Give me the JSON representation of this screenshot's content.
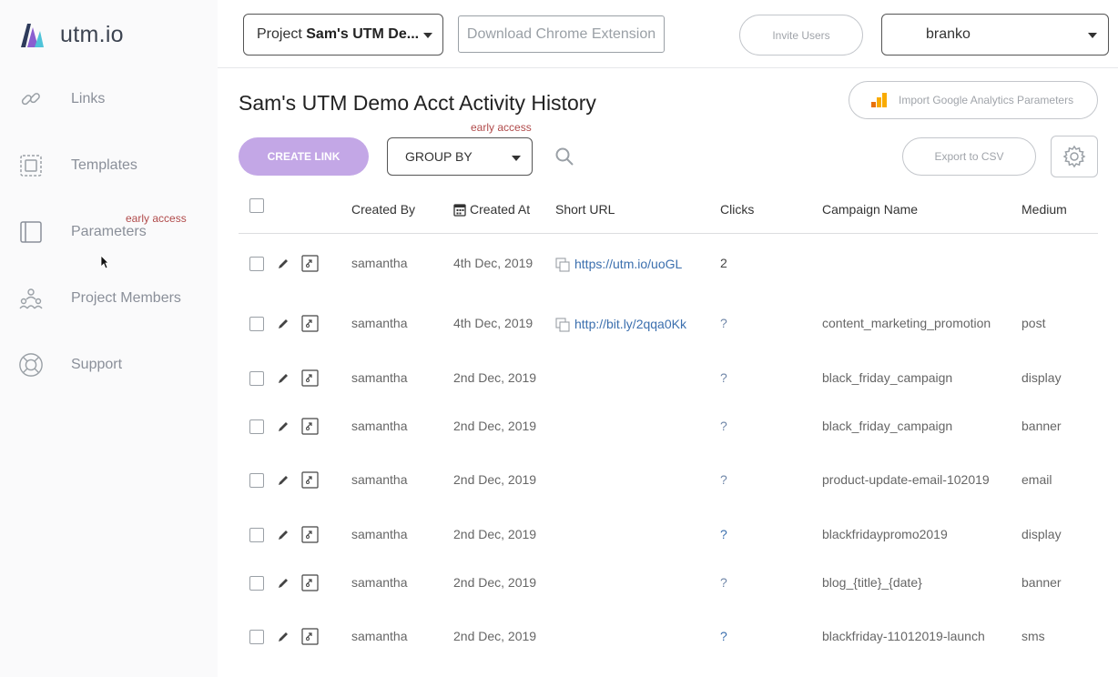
{
  "app": {
    "name": "utm.io"
  },
  "sidebar": {
    "items": [
      {
        "label": "Links",
        "icon": "link-icon"
      },
      {
        "label": "Templates",
        "icon": "template-icon"
      },
      {
        "label": "Parameters",
        "icon": "parameters-icon",
        "badge": "early access"
      },
      {
        "label": "Project Members",
        "icon": "members-icon"
      },
      {
        "label": "Support",
        "icon": "lifebuoy-icon"
      }
    ]
  },
  "header": {
    "project_prefix": "Project ",
    "project_name": "Sam's UTM De...",
    "extension_label": "Download Chrome Extension",
    "invite_label": "Invite Users",
    "user_name": "branko"
  },
  "main": {
    "title": "Sam's UTM Demo Acct Activity History",
    "import_label": "Import Google Analytics Parameters",
    "create_label": "CREATE LINK",
    "group_early": "early access",
    "group_label": "GROUP BY",
    "export_label": "Export to CSV"
  },
  "table": {
    "columns": [
      "Created By",
      "Created At",
      "Short URL",
      "Clicks",
      "Campaign Name",
      "Medium"
    ],
    "rows": [
      {
        "created_by": "samantha",
        "created_at": "4th Dec, 2019",
        "short_url": "https://utm.io/uoGL",
        "clicks": "2",
        "campaign": "",
        "medium": ""
      },
      {
        "created_by": "samantha",
        "created_at": "4th Dec, 2019",
        "short_url": "http://bit.ly/2qqa0Kk",
        "clicks": "?",
        "campaign": "content_marketing_promotion",
        "medium": "post"
      },
      {
        "created_by": "samantha",
        "created_at": "2nd Dec, 2019",
        "short_url": "",
        "clicks": "?",
        "campaign": "black_friday_campaign",
        "medium": "display"
      },
      {
        "created_by": "samantha",
        "created_at": "2nd Dec, 2019",
        "short_url": "",
        "clicks": "?",
        "campaign": "black_friday_campaign",
        "medium": "banner"
      },
      {
        "created_by": "samantha",
        "created_at": "2nd Dec, 2019",
        "short_url": "",
        "clicks": "?",
        "campaign": "product-update-email-102019",
        "medium": "email"
      },
      {
        "created_by": "samantha",
        "created_at": "2nd Dec, 2019",
        "short_url": "",
        "clicks": "?",
        "campaign": "blackfridaypromo2019",
        "medium": "display"
      },
      {
        "created_by": "samantha",
        "created_at": "2nd Dec, 2019",
        "short_url": "",
        "clicks": "?",
        "campaign": "blog_{title}_{date}",
        "medium": "banner"
      },
      {
        "created_by": "samantha",
        "created_at": "2nd Dec, 2019",
        "short_url": "",
        "clicks": "?",
        "campaign": "blackfriday-11012019-launch",
        "medium": "sms"
      }
    ]
  },
  "colors": {
    "accent": "#c3a7e6",
    "link": "#3b6fae",
    "early_access": "#b04a4a"
  }
}
